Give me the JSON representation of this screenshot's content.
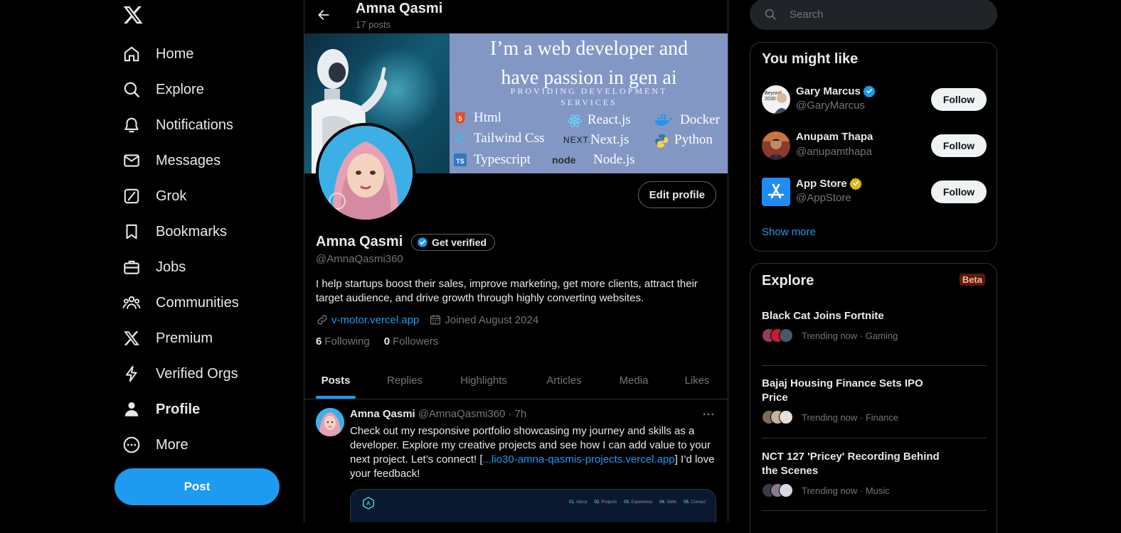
{
  "nav": {
    "items": [
      {
        "label": "Home",
        "icon": "home-icon"
      },
      {
        "label": "Explore",
        "icon": "search-icon"
      },
      {
        "label": "Notifications",
        "icon": "bell-icon"
      },
      {
        "label": "Messages",
        "icon": "mail-icon"
      },
      {
        "label": "Grok",
        "icon": "grok-icon"
      },
      {
        "label": "Bookmarks",
        "icon": "bookmark-icon"
      },
      {
        "label": "Jobs",
        "icon": "briefcase-icon"
      },
      {
        "label": "Communities",
        "icon": "people-icon"
      },
      {
        "label": "Premium",
        "icon": "x-logo-icon"
      },
      {
        "label": "Verified Orgs",
        "icon": "lightning-icon"
      },
      {
        "label": "Profile",
        "icon": "person-icon"
      },
      {
        "label": "More",
        "icon": "more-circle-icon"
      }
    ],
    "active": "Profile",
    "post_label": "Post"
  },
  "header": {
    "name": "Amna Qasmi",
    "posts_count": "17 posts"
  },
  "banner": {
    "headline_1": "I’m a web developer and",
    "headline_2": "have passion in gen ai",
    "sub_1": "PROVIDING DEVELOPMENT",
    "sub_2": "SERVICES",
    "tech": [
      "Html",
      "React.js",
      "Docker",
      "Tailwind Css",
      "Next.js",
      "Python",
      "Typescript",
      "Node.js"
    ],
    "next_logo_text": "NEXT.",
    "node_logo_text": "node"
  },
  "profile": {
    "edit_label": "Edit profile",
    "name": "Amna Qasmi",
    "verify_label": "Get verified",
    "handle": "@AmnaQasmi360",
    "bio": "I help startups boost their sales, improve marketing, get more clients, attract their target audience, and drive growth through highly converting websites.",
    "link": "v-motor.vercel.app",
    "joined": "Joined August 2024",
    "following_count": "6",
    "following_label": "Following",
    "followers_count": "0",
    "followers_label": "Followers"
  },
  "tabs": [
    "Posts",
    "Replies",
    "Highlights",
    "Articles",
    "Media",
    "Likes"
  ],
  "tweet": {
    "name": "Amna Qasmi",
    "handle": "@AmnaQasmi360",
    "sep": "·",
    "time": "7h",
    "text_before": "Check out my responsive portfolio showcasing my journey and skills as a developer. Explore my creative projects and see how I can add value to your next project. Let’s connect! [",
    "link": "...lio30-amna-qasmis-projects.vercel.app",
    "text_after": "] I’d love your feedback!",
    "media_nav": [
      {
        "num": "01.",
        "label": "About"
      },
      {
        "num": "02.",
        "label": "Projects"
      },
      {
        "num": "03.",
        "label": "Experience"
      },
      {
        "num": "04.",
        "label": "Skills"
      },
      {
        "num": "05.",
        "label": "Contact"
      }
    ],
    "media_logo": "A"
  },
  "search": {
    "placeholder": "Search"
  },
  "might_like": {
    "title": "You might like",
    "users": [
      {
        "name": "Gary Marcus",
        "handle": "@GaryMarcus",
        "badge": "blue",
        "follow": "Follow",
        "avatar_text_1": "Beyond",
        "avatar_text_2": "2030"
      },
      {
        "name": "Anupam Thapa",
        "handle": "@anupamthapa",
        "badge": "",
        "follow": "Follow"
      },
      {
        "name": "App Store",
        "handle": "@AppStore",
        "badge": "gold",
        "follow": "Follow"
      }
    ],
    "show_more": "Show more"
  },
  "explore": {
    "title": "Explore",
    "beta": "Beta",
    "trends": [
      {
        "title": "Black Cat Joins Fortnite",
        "meta": "Trending now · Gaming"
      },
      {
        "title": "Bajaj Housing Finance Sets IPO Price",
        "meta": "Trending now · Finance"
      },
      {
        "title": "NCT 127 'Pricey' Recording Behind the Scenes",
        "meta": "Trending now · Music"
      }
    ]
  },
  "colors": {
    "accent": "#1d9bf0",
    "background": "#000000",
    "border": "#2f3336",
    "muted_text": "#71767b",
    "primary_text": "#e7e9ea",
    "verified_gold": "#e2b719"
  }
}
